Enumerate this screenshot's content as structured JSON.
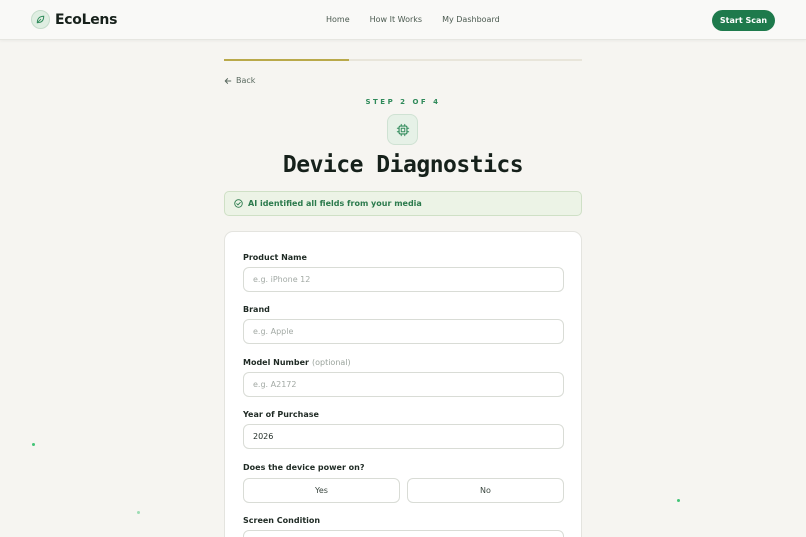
{
  "app": {
    "name": "EcoLens",
    "logo_icon": "leaf-icon"
  },
  "nav": {
    "links": [
      "Home",
      "How It Works",
      "My Dashboard"
    ],
    "cta": "Start Scan"
  },
  "progress": {
    "current_step": 2,
    "total_steps": 4,
    "fill_fraction": 0.35
  },
  "back_label": "Back",
  "step_label": "STEP 2 OF 4",
  "header_icon": "chip-icon",
  "title": "Device Diagnostics",
  "ai_banner": {
    "text": "AI identified all fields from your media",
    "icon": "check-circle-icon"
  },
  "form": {
    "product_name": {
      "label": "Product Name",
      "value": "",
      "placeholder": "e.g. iPhone 12"
    },
    "brand": {
      "label": "Brand",
      "value": "",
      "placeholder": "e.g. Apple"
    },
    "model_number": {
      "label": "Model Number",
      "optional": "(optional)",
      "value": "",
      "placeholder": "e.g. A2172"
    },
    "year": {
      "label": "Year of Purchase",
      "value": "2026"
    },
    "power": {
      "label": "Does the device power on?",
      "options": [
        "Yes",
        "No"
      ]
    },
    "screen": {
      "label": "Screen Condition"
    }
  },
  "colors": {
    "accent": "#1e7a4c",
    "banner_bg": "#ecf3e6",
    "progress": "#b9a94a",
    "background": "#f6f5f1"
  }
}
